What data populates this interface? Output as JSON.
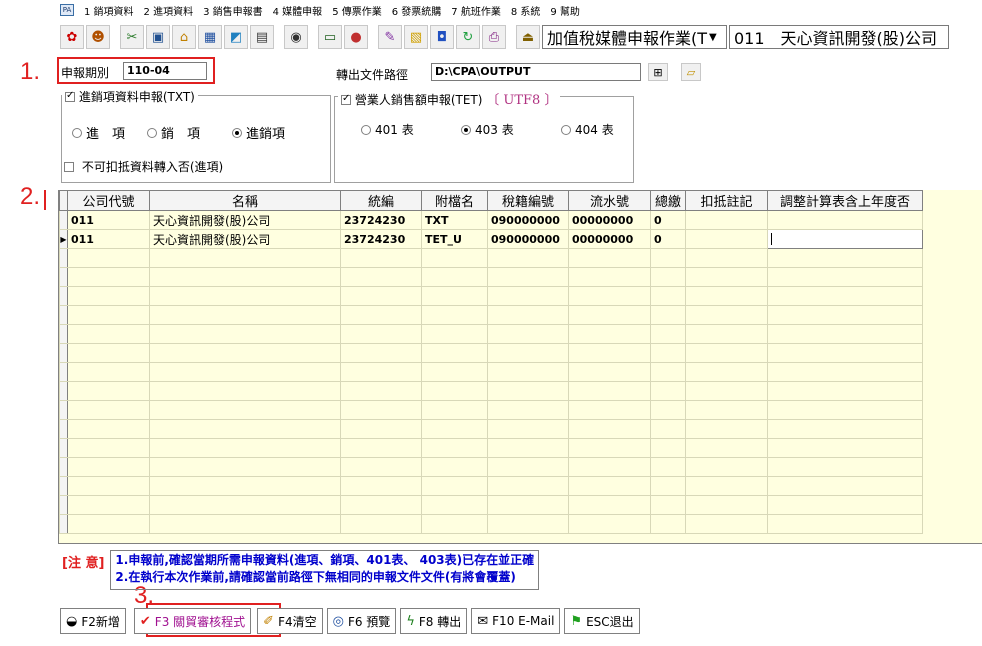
{
  "menu": {
    "app_icon": "PA",
    "items": [
      "1 銷項資料",
      "2 進項資料",
      "3 銷售申報書",
      "4 媒體申報",
      "5 傳票作業",
      "6 發票統購",
      "7 航班作業",
      "8 系統",
      "9 幫助"
    ]
  },
  "toolbar": {
    "icons": [
      "ladybug-icon",
      "people-icon",
      "cut-icon",
      "save-icon",
      "home-icon",
      "calculator-icon",
      "chart-icon",
      "calc-icon",
      "eye-icon",
      "monitor-icon",
      "globe-icon",
      "brush-icon",
      "document-icon",
      "camera-icon",
      "refresh-icon",
      "print-icon",
      "exit-icon"
    ],
    "task_select": "加值稅媒體申報作業(T",
    "company_select": "011　天心資訊開發(股)公司"
  },
  "markers": {
    "m1": "1.",
    "m2": "2.",
    "m3": "3."
  },
  "form": {
    "period_label": "申報期別",
    "period_value": "110-04",
    "path_label": "轉出文件路徑",
    "path_value": "D:\\CPA\\OUTPUT",
    "sales_group_title": "進銷項資料申報(TXT)",
    "radio_in": "進　項",
    "radio_out": "銷　項",
    "radio_both": "進銷項",
    "nondeduct_label": "不可扣抵資料轉入否(進項)",
    "tet_group_title": "營業人銷售額申報(TET)",
    "tet_encoding": "〔 UTF8 〕",
    "form_401": "401 表",
    "form_403": "403 表",
    "form_404": "404 表"
  },
  "grid": {
    "columns": [
      "公司代號",
      "名稱",
      "統編",
      "附檔名",
      "稅籍編號",
      "流水號",
      "總繳",
      "扣抵註記",
      "調整計算表含上年度否"
    ],
    "rows": [
      {
        "company_code": "011",
        "name": "天心資訊開發(股)公司",
        "tax_id": "23724230",
        "ext": "TXT",
        "reg_no": "090000000",
        "serial": "00000000",
        "total": "0",
        "deduct": "",
        "adjust": ""
      },
      {
        "company_code": "011",
        "name": "天心資訊開發(股)公司",
        "tax_id": "23724230",
        "ext": "TET_U",
        "reg_no": "090000000",
        "serial": "00000000",
        "total": "0",
        "deduct": "",
        "adjust": ""
      }
    ]
  },
  "notes": {
    "title": "[注 意]",
    "line1": "1.申報前,確認當期所需申報資料(進項、銷項、401表、 403表)已存在並正確",
    "line2": "2.在執行本次作業前,請確認當前路徑下無相同的申報文件文件(有將會覆蓋)"
  },
  "buttons": {
    "f2": "F2新增",
    "f3": "F3 關貿審核程式",
    "f4": "F4清空",
    "f6": "F6 預覽",
    "f8": "F8 轉出",
    "f10": "F10 E-Mail",
    "esc": "ESC退出"
  },
  "colors": {
    "marker_red": "#e02020",
    "notes_blue": "#0000cc",
    "grid_bg": "#ffffe0",
    "f3_text": "#a01090"
  }
}
